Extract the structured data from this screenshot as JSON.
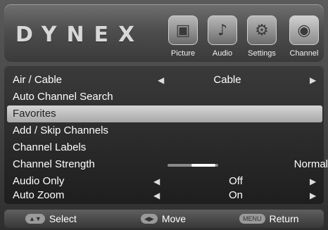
{
  "brand": {
    "logo": "DYNEX"
  },
  "tabs": [
    {
      "label": "Picture",
      "icon": "picture-icon"
    },
    {
      "label": "Audio",
      "icon": "audio-icon"
    },
    {
      "label": "Settings",
      "icon": "settings-icon"
    },
    {
      "label": "Channel",
      "icon": "channel-icon"
    }
  ],
  "menu": [
    {
      "label": "Air / Cable",
      "value": "Cable"
    },
    {
      "label": "Auto Channel Search"
    },
    {
      "label": "Favorites"
    },
    {
      "label": "Add / Skip Channels"
    },
    {
      "label": "Channel Labels"
    },
    {
      "label": "Channel Strength",
      "value": "Normal",
      "level": 0.5
    },
    {
      "label": "Audio Only",
      "value": "Off"
    },
    {
      "label": "Auto Zoom",
      "value": "On"
    }
  ],
  "footer": {
    "select_label": "Select",
    "move_label": "Move",
    "menu_key": "MENU",
    "return_label": "Return"
  }
}
